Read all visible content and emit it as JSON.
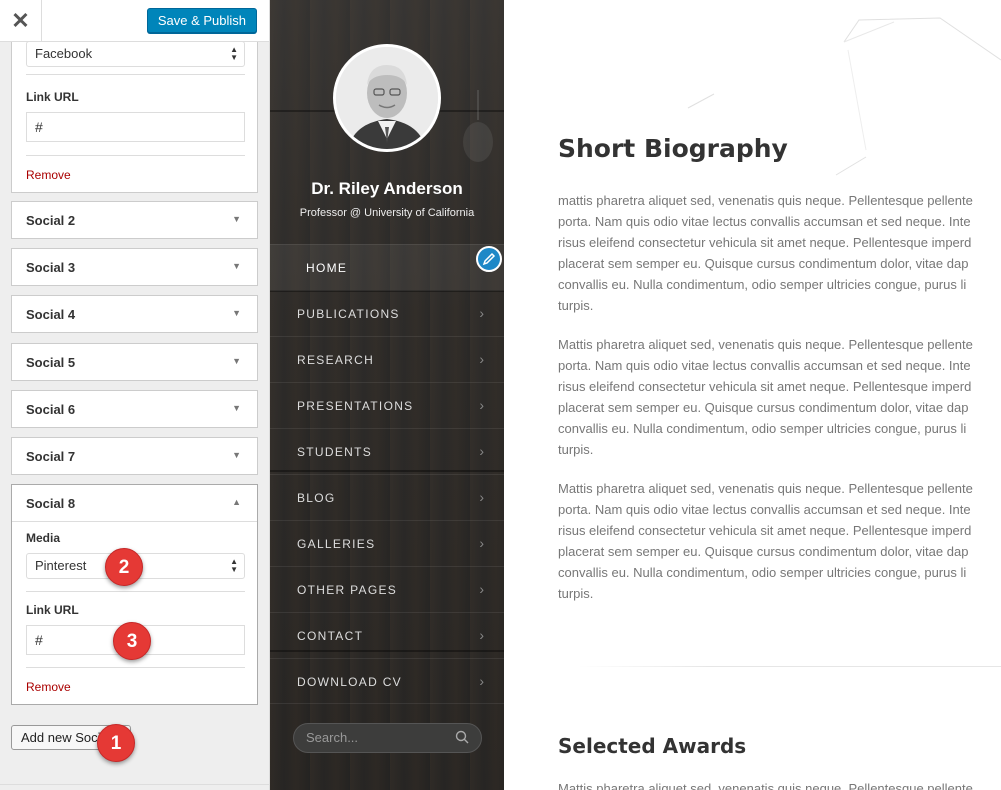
{
  "customizer": {
    "close_glyph": "✕",
    "publish_label": "Save & Publish",
    "top_block": {
      "media_value": "Facebook",
      "link_label": "Link URL",
      "link_value": "#",
      "remove_label": "Remove"
    },
    "items": [
      {
        "label": "Social 2"
      },
      {
        "label": "Social 3"
      },
      {
        "label": "Social 4"
      },
      {
        "label": "Social 5"
      },
      {
        "label": "Social 6"
      },
      {
        "label": "Social 7"
      }
    ],
    "open_item": {
      "label": "Social 8",
      "media_label": "Media",
      "media_value": "Pinterest",
      "link_label": "Link URL",
      "link_value": "#",
      "remove_label": "Remove"
    },
    "add_label": "Add new Social"
  },
  "badges": {
    "one": "1",
    "two": "2",
    "three": "3"
  },
  "sidebar": {
    "name": "Dr. Riley Anderson",
    "role": "Professor @ University of California",
    "nav": [
      {
        "label": "HOME"
      },
      {
        "label": "PUBLICATIONS"
      },
      {
        "label": "RESEARCH"
      },
      {
        "label": "PRESENTATIONS"
      },
      {
        "label": "STUDENTS"
      },
      {
        "label": "BLOG"
      },
      {
        "label": "GALLERIES"
      },
      {
        "label": "OTHER PAGES"
      },
      {
        "label": "CONTACT"
      },
      {
        "label": "DOWNLOAD CV"
      }
    ],
    "search_placeholder": "Search..."
  },
  "main": {
    "bio_title": "Short Biography",
    "paragraphs": [
      [
        "mattis pharetra aliquet sed, venenatis quis neque. Pellentesque pellente",
        "porta. Nam quis odio vitae lectus convallis accumsan et sed neque. Inte",
        "risus eleifend consectetur vehicula sit amet neque. Pellentesque imperd",
        "placerat sem semper eu. Quisque cursus condimentum dolor, vitae dap",
        "convallis eu. Nulla condimentum, odio semper ultricies congue, purus li",
        "turpis."
      ],
      [
        "Mattis pharetra aliquet sed, venenatis quis neque. Pellentesque pellente",
        "porta. Nam quis odio vitae lectus convallis accumsan et sed neque. Inte",
        "risus eleifend consectetur vehicula sit amet neque. Pellentesque imperd",
        "placerat sem semper eu. Quisque cursus condimentum dolor, vitae dap",
        "convallis eu. Nulla condimentum, odio semper ultricies congue, purus li",
        "turpis."
      ],
      [
        "Mattis pharetra aliquet sed, venenatis quis neque. Pellentesque pellente",
        "porta. Nam quis odio vitae lectus convallis accumsan et sed neque. Inte",
        "risus eleifend consectetur vehicula sit amet neque. Pellentesque imperd",
        "placerat sem semper eu. Quisque cursus condimentum dolor, vitae dap",
        "convallis eu. Nulla condimentum, odio semper ultricies congue, purus li",
        "turpis."
      ]
    ],
    "awards_title": "Selected Awards",
    "awards_snippet": "Mattis pharetra aliquet sed, venenatis quis neque. Pellentesque pellente"
  },
  "colors": {
    "publish": "#0085ba",
    "remove": "#aa0000",
    "badge": "#e53935",
    "edit": "#1e88c7"
  }
}
